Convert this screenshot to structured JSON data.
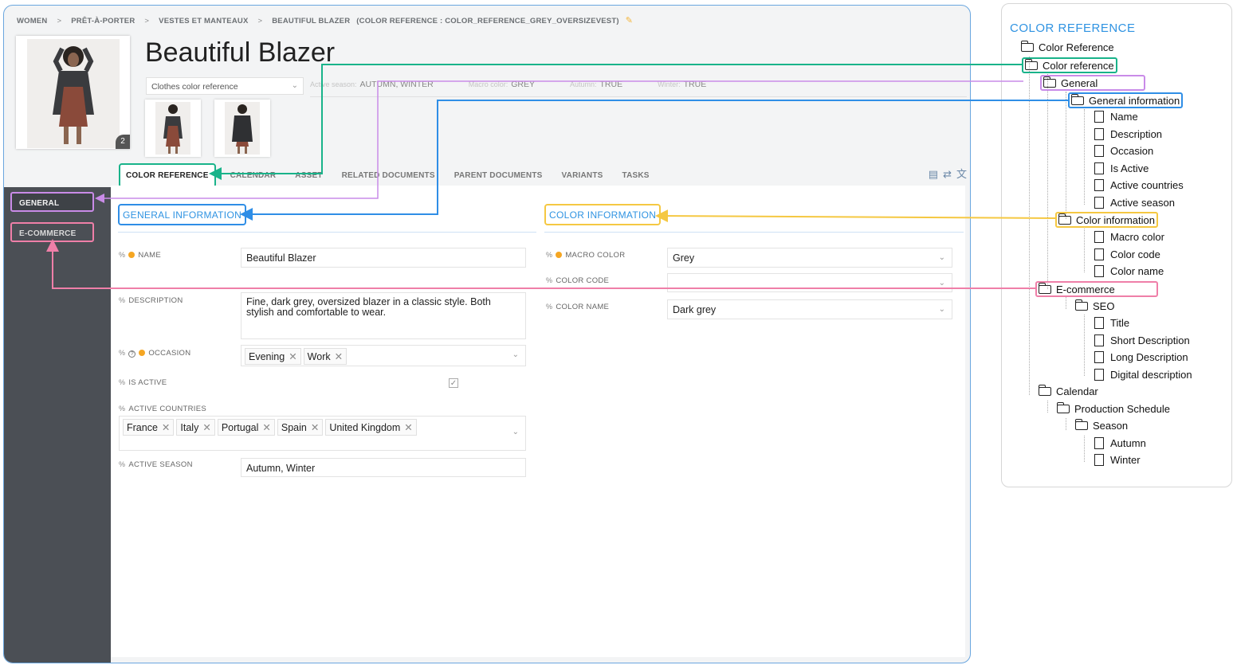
{
  "breadcrumb": {
    "items": [
      "WOMEN",
      "PRÊT-À-PORTER",
      "VESTES ET MANTEAUX",
      "BEAUTIFUL BLAZER"
    ],
    "separator": ">",
    "reference": "(COLOR REFERENCE : COLOR_REFERENCE_GREY_OVERSIZEVEST)",
    "edit_icon": "pencil-icon"
  },
  "product": {
    "title": "Beautiful Blazer",
    "image_count": "2",
    "color_reference_select": "Clothes color reference"
  },
  "meta": [
    {
      "label": "Active season:",
      "value": "AUTUMN, WINTER"
    },
    {
      "label": "Macro color:",
      "value": "GREY"
    },
    {
      "label": "Autumn:",
      "value": "TRUE"
    },
    {
      "label": "Winter:",
      "value": "TRUE"
    }
  ],
  "tabs": [
    "COLOR REFERENCE",
    "CALENDAR",
    "ASSET",
    "RELATED DOCUMENTS",
    "PARENT DOCUMENTS",
    "VARIANTS",
    "TASKS"
  ],
  "sidebar": {
    "items": [
      "GENERAL",
      "E-COMMERCE"
    ]
  },
  "general": {
    "heading": "GENERAL INFORMATION",
    "name": {
      "label": "NAME",
      "value": "Beautiful Blazer"
    },
    "description": {
      "label": "DESCRIPTION",
      "value": "Fine, dark grey, oversized blazer in a classic style. Both stylish and comfortable to wear."
    },
    "occasion": {
      "label": "OCCASION",
      "tags": [
        "Evening",
        "Work"
      ]
    },
    "is_active": {
      "label": "IS ACTIVE",
      "checked": true
    },
    "active_countries": {
      "label": "ACTIVE COUNTRIES",
      "tags": [
        "France",
        "Italy",
        "Portugal",
        "Spain",
        "United Kingdom"
      ]
    },
    "active_season": {
      "label": "ACTIVE SEASON",
      "value": "Autumn, Winter"
    }
  },
  "color": {
    "heading": "COLOR INFORMATION",
    "macro_color": {
      "label": "MACRO COLOR",
      "value": "Grey"
    },
    "color_code": {
      "label": "COLOR CODE",
      "value": ""
    },
    "color_name": {
      "label": "COLOR NAME",
      "value": "Dark grey"
    }
  },
  "tree": {
    "title": "COLOR REFERENCE",
    "nodes": [
      "Color Reference",
      "Color reference",
      "General",
      "General information",
      "Name",
      "Description",
      "Occasion",
      "Is Active",
      "Active countries",
      "Active season",
      "Color information",
      "Macro color",
      "Color code",
      "Color name",
      "E-commerce",
      "SEO",
      "Title",
      "Short Description",
      "Long Description",
      "Digital description",
      "Calendar",
      "Production Schedule",
      "Season",
      "Autumn",
      "Winter"
    ]
  },
  "colors": {
    "accent_blue": "#2f93e2",
    "green": "#19b38a",
    "purple": "#c98be8",
    "yellow": "#f5c842",
    "pink": "#ef7fa8",
    "required_dot": "#f5a623",
    "sidebar_bg": "#4b4f55"
  }
}
